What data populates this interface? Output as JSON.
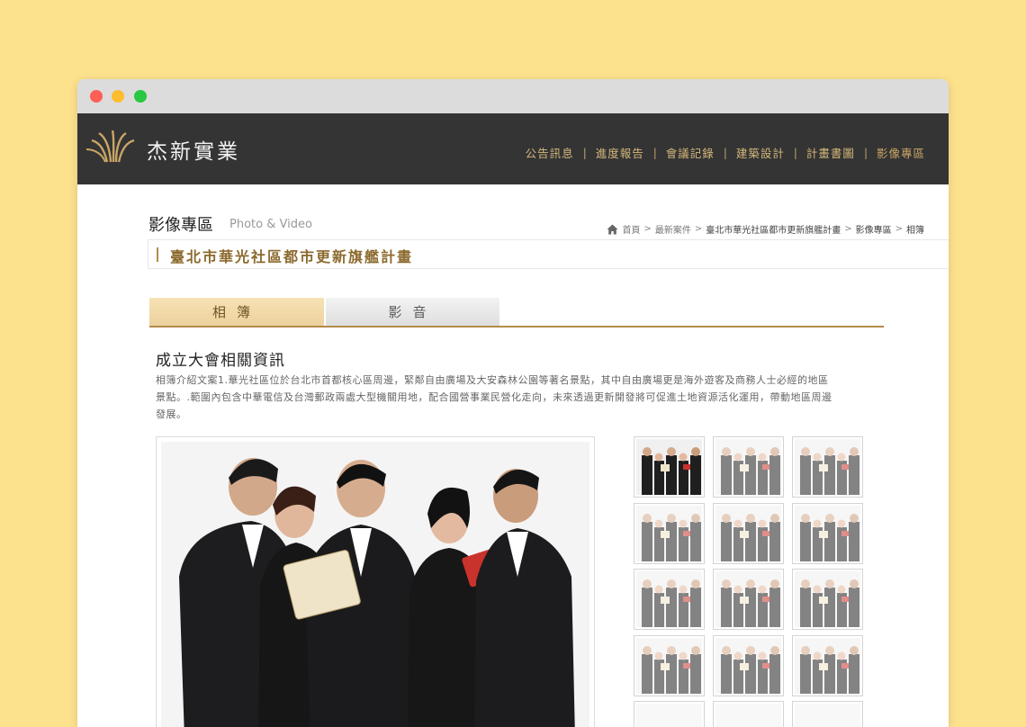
{
  "header": {
    "brand": "杰新實業",
    "nav": [
      "公告訊息",
      "進度報告",
      "會議記錄",
      "建築設計",
      "計畫書圖",
      "影像專區"
    ],
    "active_nav": "影像專區"
  },
  "page": {
    "title": "影像專區",
    "subtitle": "Photo & Video",
    "breadcrumb": [
      "首頁",
      "最新案件",
      "臺北市華光社區都市更新旗艦計畫",
      "影像專區",
      "相簿"
    ],
    "project_title": "臺北市華光社區都市更新旗艦計畫"
  },
  "tabs": {
    "photo": "相簿",
    "video": "影音"
  },
  "album": {
    "heading": "成立大會相關資訊",
    "description_line1": "相簿介紹文案1.華光社區位於台北市首都核心區周邊，緊鄰自由廣場及大安森林公園等著名景點，其中自由廣場更是海外遊客及商務人士必經的地區",
    "description_line2": "景點。.範圍內包含中華電信及台灣郵政兩處大型機關用地，配合國營事業民營化走向，未來透過更新開發將可促進土地資源活化運用，帶動地區周邊",
    "description_line3": "發展。"
  },
  "colors": {
    "background": "#fde28e",
    "header": "#343434",
    "accent_gold": "#b28b49",
    "nav_text": "#d4b77a"
  },
  "icons": [
    "home-icon",
    "logo-icon"
  ]
}
